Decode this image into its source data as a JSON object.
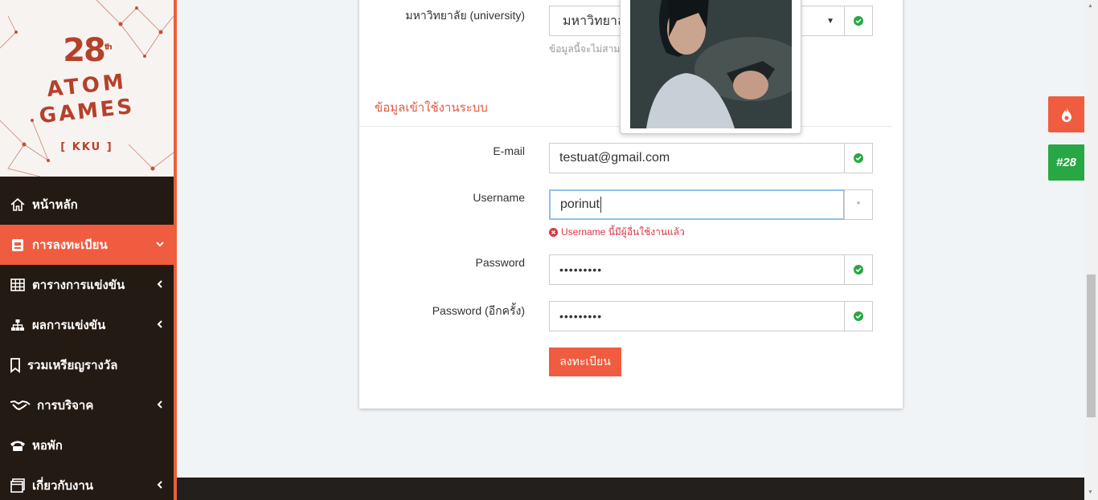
{
  "sidebar": {
    "logo": {
      "number": "28",
      "sup": "th",
      "line1": "ATOM",
      "line2": "GAMES",
      "line3": "[ KKU ]"
    },
    "items": [
      {
        "label": "หน้าหลัก",
        "icon": "home-icon",
        "active": false,
        "chevron": ""
      },
      {
        "label": "การลงทะเบียน",
        "icon": "registration-icon",
        "active": true,
        "chevron": "down"
      },
      {
        "label": "ตารางการแข่งขัน",
        "icon": "table-grid-icon",
        "active": false,
        "chevron": "left"
      },
      {
        "label": "ผลการแข่งขัน",
        "icon": "sitemap-icon",
        "active": false,
        "chevron": "left"
      },
      {
        "label": "รวมเหรียญรางวัล",
        "icon": "bookmark-icon",
        "active": false,
        "chevron": ""
      },
      {
        "label": "การบริจาค",
        "icon": "handshake-icon",
        "active": false,
        "chevron": "left"
      },
      {
        "label": "หอพัก",
        "icon": "phone-icon",
        "active": false,
        "chevron": ""
      },
      {
        "label": "เกี่ยวกับงาน",
        "icon": "window-icon",
        "active": false,
        "chevron": "left"
      }
    ]
  },
  "form": {
    "university": {
      "label": "มหาวิทยาลัย (university)",
      "value": "มหาวิทยาลั",
      "help": "ข้อมูลนี้จะไม่สามา"
    },
    "section_title": "ข้อมูลเข้าใช้งานระบบ",
    "email": {
      "label": "E-mail",
      "value": "testuat@gmail.com"
    },
    "username": {
      "label": "Username",
      "value": "porinut",
      "required_mark": "*",
      "error": "Username นี้มีผู้อื่นใช้งานแล้ว"
    },
    "password": {
      "label": "Password",
      "value": "•••••••••"
    },
    "password_confirm": {
      "label": "Password (อีกครั้ง)",
      "value": "•••••••••"
    },
    "submit_label": "ลงทะเบียน"
  },
  "floating": {
    "flame_label": "",
    "tag_label": "#28"
  },
  "colors": {
    "accent": "#f05c3f",
    "sidebar_bg": "#231a14",
    "success": "#28a745",
    "error": "#dc3545",
    "green_fab": "#28a745"
  }
}
